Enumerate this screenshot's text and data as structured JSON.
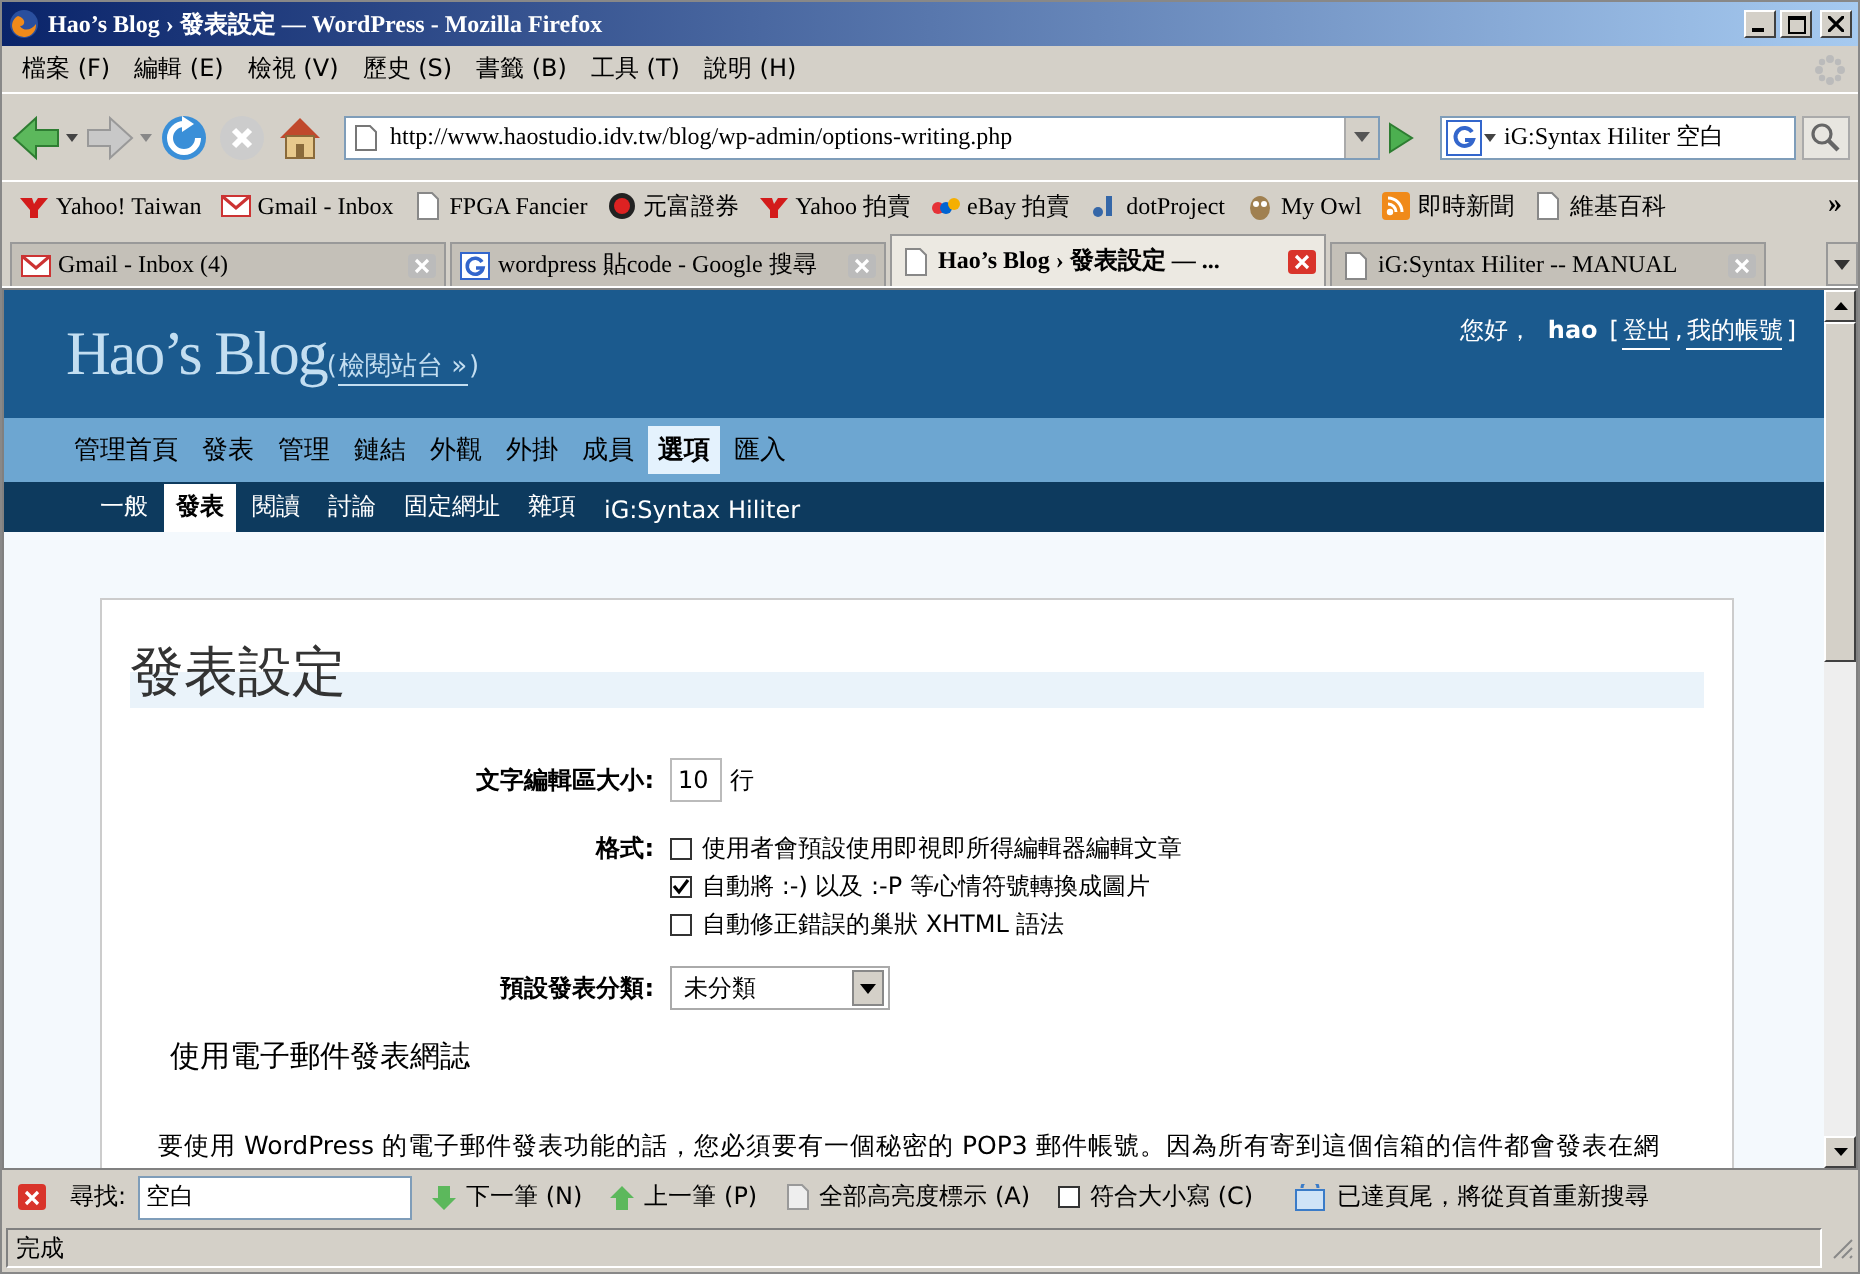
{
  "window": {
    "title": "Hao’s Blog › 發表設定 — WordPress - Mozilla Firefox"
  },
  "menu": [
    "檔案 (F)",
    "編輯 (E)",
    "檢視 (V)",
    "歷史 (S)",
    "書籤 (B)",
    "工具 (T)",
    "說明 (H)"
  ],
  "toolbar": {
    "url": "http://www.haostudio.idv.tw/blog/wp-admin/options-writing.php",
    "search": "iG:Syntax Hiliter 空白"
  },
  "bookmarks": [
    {
      "label": "Yahoo! Taiwan",
      "kind": "yahoo"
    },
    {
      "label": "Gmail - Inbox",
      "kind": "mail"
    },
    {
      "label": "FPGA Fancier",
      "kind": "page"
    },
    {
      "label": "元富證券",
      "kind": "circle"
    },
    {
      "label": "Yahoo 拍賣",
      "kind": "yahoo"
    },
    {
      "label": "eBay 拍賣",
      "kind": "ebay"
    },
    {
      "label": "dotProject",
      "kind": "dots"
    },
    {
      "label": "My Owl",
      "kind": "owl"
    },
    {
      "label": "即時新聞",
      "kind": "feed"
    },
    {
      "label": "維基百科",
      "kind": "page"
    }
  ],
  "bookmarks_more": "»",
  "tabs": [
    {
      "label": "Gmail - Inbox (4)",
      "kind": "mail",
      "selected": false
    },
    {
      "label": "wordpress 貼code - Google 搜尋",
      "kind": "google",
      "selected": false
    },
    {
      "label": "Hao’s Blog › 發表設定 — ...",
      "kind": "page",
      "selected": true
    },
    {
      "label": "iG:Syntax Hiliter -- MANUAL",
      "kind": "page",
      "selected": false
    }
  ],
  "blog": {
    "title": "Hao’s Blog",
    "view_site_brackets": [
      "(",
      ")"
    ],
    "view_site": "檢閱站台 »",
    "greeting": "您好，",
    "user": "hao",
    "user_punct": [
      "[",
      ",",
      "]"
    ],
    "logout": "登出",
    "account": "我的帳號"
  },
  "nav": [
    {
      "label": "管理首頁",
      "selected": false
    },
    {
      "label": "發表",
      "selected": false
    },
    {
      "label": "管理",
      "selected": false
    },
    {
      "label": "鏈結",
      "selected": false
    },
    {
      "label": "外觀",
      "selected": false
    },
    {
      "label": "外掛",
      "selected": false
    },
    {
      "label": "成員",
      "selected": false
    },
    {
      "label": "選項",
      "selected": true
    },
    {
      "label": "匯入",
      "selected": false
    }
  ],
  "subnav": [
    {
      "label": "一般",
      "selected": false
    },
    {
      "label": "發表",
      "selected": true
    },
    {
      "label": "閱讀",
      "selected": false
    },
    {
      "label": "討論",
      "selected": false
    },
    {
      "label": "固定網址",
      "selected": false
    },
    {
      "label": "雜項",
      "selected": false
    },
    {
      "label": "iG:Syntax Hiliter",
      "selected": false
    }
  ],
  "page": {
    "heading": "發表設定",
    "size": {
      "label": "文字編輯區大小:",
      "value": "10",
      "unit": "行"
    },
    "format": {
      "label": "格式:",
      "options": [
        {
          "label": "使用者會預設使用即視即所得編輯器編輯文章",
          "checked": false
        },
        {
          "label": "自動將 :-) 以及 :-P 等心情符號轉換成圖片",
          "checked": true
        },
        {
          "label": "自動修正錯誤的巢狀 XHTML 語法",
          "checked": false
        }
      ]
    },
    "category": {
      "label": "預設發表分類:",
      "value": "未分類"
    },
    "email_heading": "使用電子郵件發表網誌",
    "email_text": "要使用 WordPress 的電子郵件發表功能的話，您必須要有一個秘密的 POP3 郵件帳號。因為所有寄到這個信箱的信件都會發表在網"
  },
  "find_bar": {
    "label": "尋找:",
    "value": "空白",
    "next": "下一筆 (N)",
    "prev": "上一筆 (P)",
    "highlight": "全部高亮度標示 (A)",
    "match_case": {
      "label": "符合大小寫 (C)",
      "checked": false
    },
    "message": "已達頁尾，將從頁首重新搜尋"
  },
  "status": "完成"
}
